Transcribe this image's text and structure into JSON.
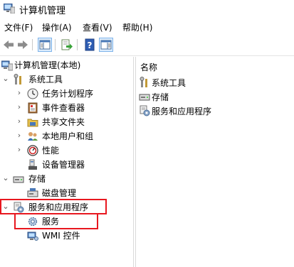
{
  "window": {
    "title": "计算机管理"
  },
  "menu": [
    "文件(F)",
    "操作(A)",
    "查看(V)",
    "帮助(H)"
  ],
  "tree": {
    "root": "计算机管理(本地)",
    "system_tools": "系统工具",
    "task_scheduler": "任务计划程序",
    "event_viewer": "事件查看器",
    "shared_folders": "共享文件夹",
    "local_users": "本地用户和组",
    "performance": "性能",
    "device_manager": "设备管理器",
    "storage": "存储",
    "disk_management": "磁盘管理",
    "services_apps": "服务和应用程序",
    "services": "服务",
    "wmi_control": "WMI 控件"
  },
  "list": {
    "column_header": "名称",
    "items": [
      "系统工具",
      "存储",
      "服务和应用程序"
    ]
  },
  "colors": {
    "highlight": "#e8171f",
    "selection": "#cce8ff"
  }
}
